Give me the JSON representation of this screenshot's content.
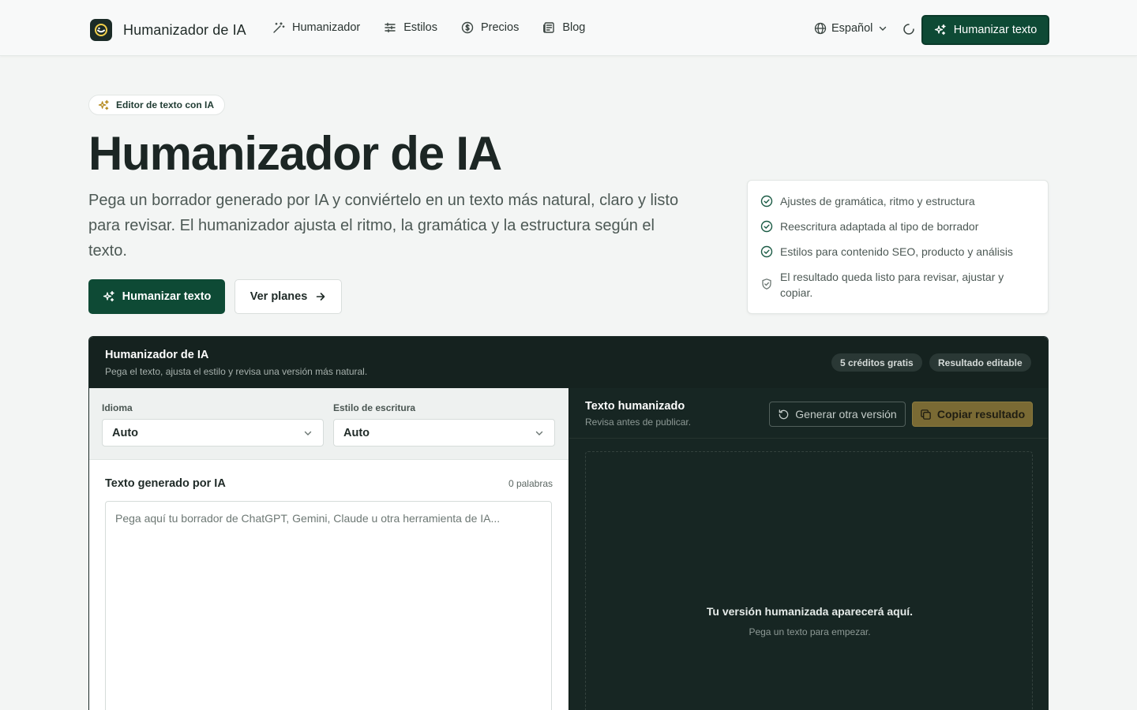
{
  "header": {
    "brand": "Humanizador de IA",
    "nav": [
      {
        "label": "Humanizador",
        "icon": "magic-wand-icon"
      },
      {
        "label": "Estilos",
        "icon": "sliders-icon"
      },
      {
        "label": "Precios",
        "icon": "dollar-coin-icon"
      },
      {
        "label": "Blog",
        "icon": "newspaper-icon"
      }
    ],
    "language": "Español",
    "cta_label": "Humanizar texto"
  },
  "hero": {
    "pill_label": "Editor de texto con IA",
    "title": "Humanizador de IA",
    "description": "Pega un borrador generado por IA y conviértelo en un texto más natural, claro y listo para revisar. El humanizador ajusta el ritmo, la gramática y la estructura según el texto.",
    "primary_label": "Humanizar texto",
    "secondary_label": "Ver planes"
  },
  "features": [
    {
      "text": "Ajustes de gramática, ritmo y estructura",
      "icon": "check-circle-icon"
    },
    {
      "text": "Reescritura adaptada al tipo de borrador",
      "icon": "check-circle-icon"
    },
    {
      "text": "Estilos para contenido SEO, producto y análisis",
      "icon": "check-circle-icon"
    },
    {
      "text": "El resultado queda listo para revisar, ajustar y copiar.",
      "icon": "shield-check-icon"
    }
  ],
  "tool": {
    "title": "Humanizador de IA",
    "subtitle": "Pega el texto, ajusta el estilo y revisa una versión más natural.",
    "badges": [
      "5 créditos gratis",
      "Resultado editable"
    ],
    "language_label": "Idioma",
    "language_value": "Auto",
    "style_label": "Estilo de escritura",
    "style_value": "Auto",
    "input_title": "Texto generado por IA",
    "word_count": "0 palabras",
    "input_placeholder": "Pega aquí tu borrador de ChatGPT, Gemini, Claude u otra herramienta de IA...",
    "output_title": "Texto humanizado",
    "output_subtitle": "Revisa antes de publicar.",
    "regen_label": "Generar otra versión",
    "copy_label": "Copiar resultado",
    "empty_title": "Tu versión humanizada aparecerá aquí.",
    "empty_subtitle": "Pega un texto para empezar."
  },
  "colors": {
    "brand_green": "#0e4a35",
    "dark_panel": "#15221f",
    "gold": "#7a6a34",
    "page_bg": "#f3f5f4"
  }
}
